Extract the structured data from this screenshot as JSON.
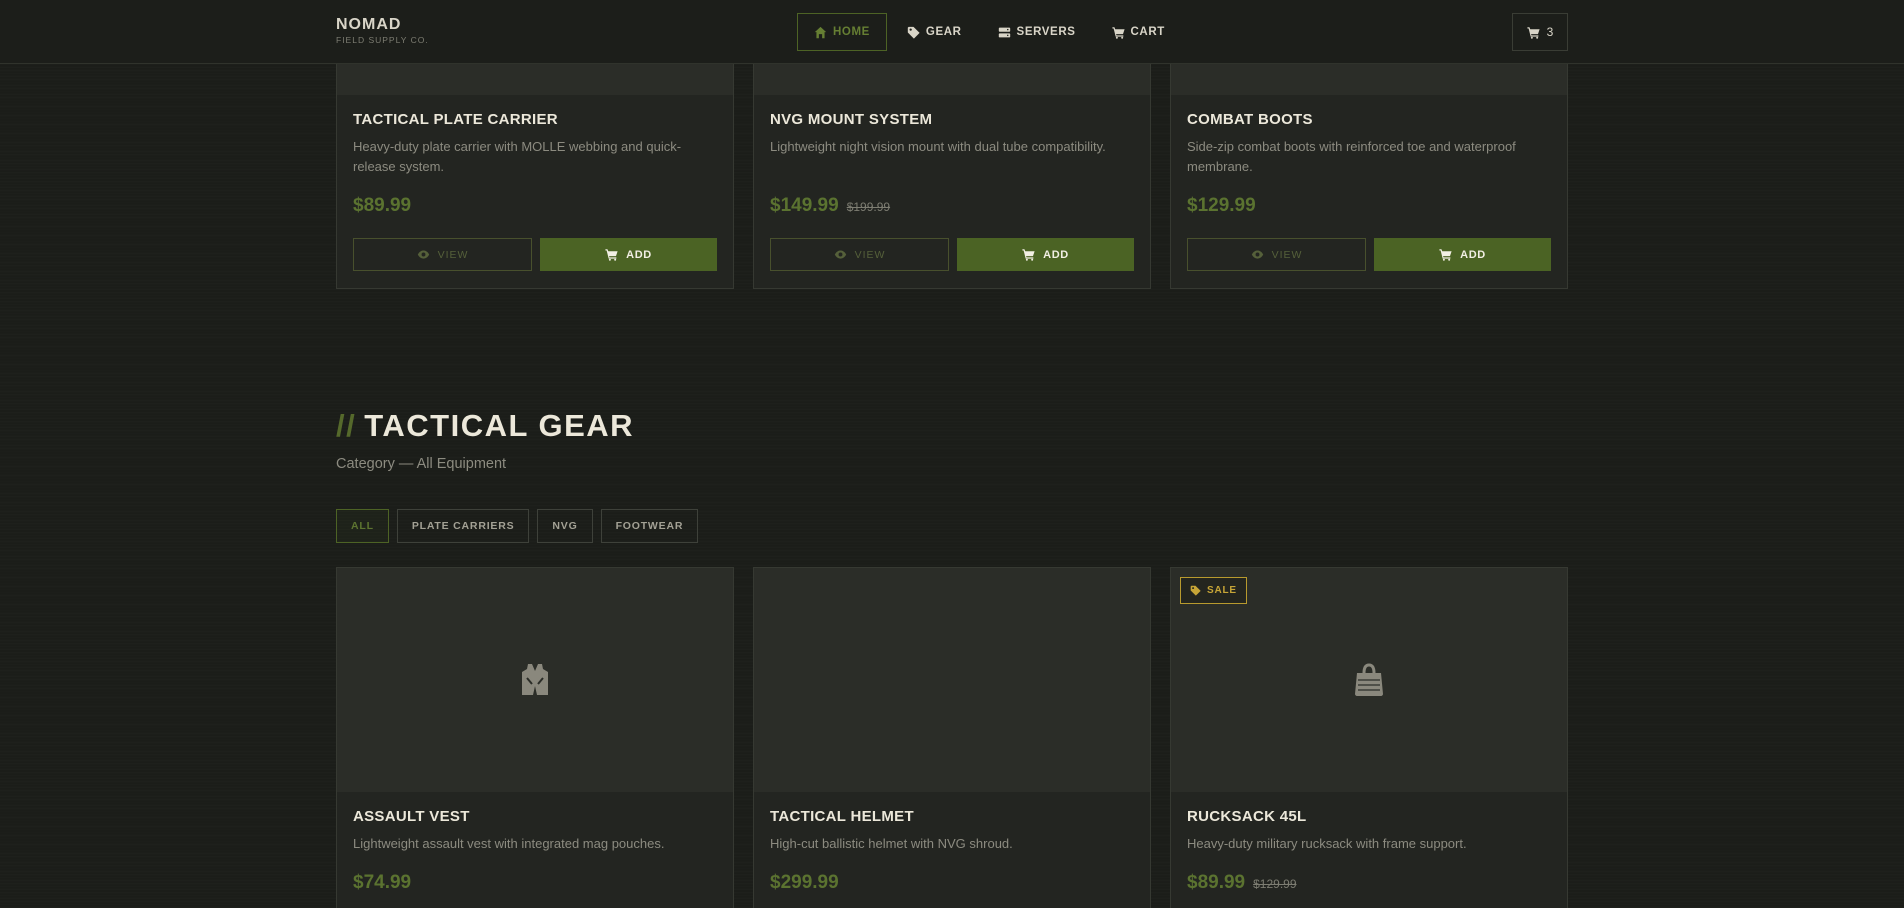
{
  "brand": {
    "name": "NOMAD",
    "subtitle": "FIELD SUPPLY CO."
  },
  "nav": {
    "items": [
      {
        "label": "HOME",
        "icon": "home-icon",
        "active": true
      },
      {
        "label": "GEAR",
        "icon": "tag-icon",
        "active": false
      },
      {
        "label": "SERVERS",
        "icon": "server-icon",
        "active": false
      },
      {
        "label": "CART",
        "icon": "cart-icon",
        "active": false
      }
    ],
    "cart_count": "3"
  },
  "featured": [
    {
      "title": "TACTICAL PLATE CARRIER",
      "description": "Heavy-duty plate carrier with MOLLE webbing and quick-release system.",
      "price": "$89.99",
      "old_price": ""
    },
    {
      "title": "NVG MOUNT SYSTEM",
      "description": "Lightweight night vision mount with dual tube compatibility.",
      "price": "$149.99",
      "old_price": "$199.99"
    },
    {
      "title": "COMBAT BOOTS",
      "description": "Side-zip combat boots with reinforced toe and waterproof membrane.",
      "price": "$129.99",
      "old_price": ""
    }
  ],
  "buttons": {
    "view": "VIEW",
    "add": "ADD"
  },
  "section": {
    "slashes": "//",
    "title": "TACTICAL GEAR",
    "subtitle": "Category — All Equipment",
    "filters": [
      "ALL",
      "PLATE CARRIERS",
      "NVG",
      "FOOTWEAR"
    ]
  },
  "products": [
    {
      "title": "ASSAULT VEST",
      "description": "Lightweight assault vest with integrated mag pouches.",
      "price": "$74.99",
      "old_price": "",
      "icon": "vest-icon",
      "badge": ""
    },
    {
      "title": "TACTICAL HELMET",
      "description": "High-cut ballistic helmet with NVG shroud.",
      "price": "$299.99",
      "old_price": "",
      "icon": "",
      "badge": ""
    },
    {
      "title": "RUCKSACK 45L",
      "description": "Heavy-duty military rucksack with frame support.",
      "price": "$89.99",
      "old_price": "$129.99",
      "icon": "bag-icon",
      "badge": "SALE"
    }
  ],
  "colors": {
    "accent": "#4b6324",
    "accent_text": "#5b7330",
    "sale": "#c7a537",
    "background": "#1b1d19"
  }
}
